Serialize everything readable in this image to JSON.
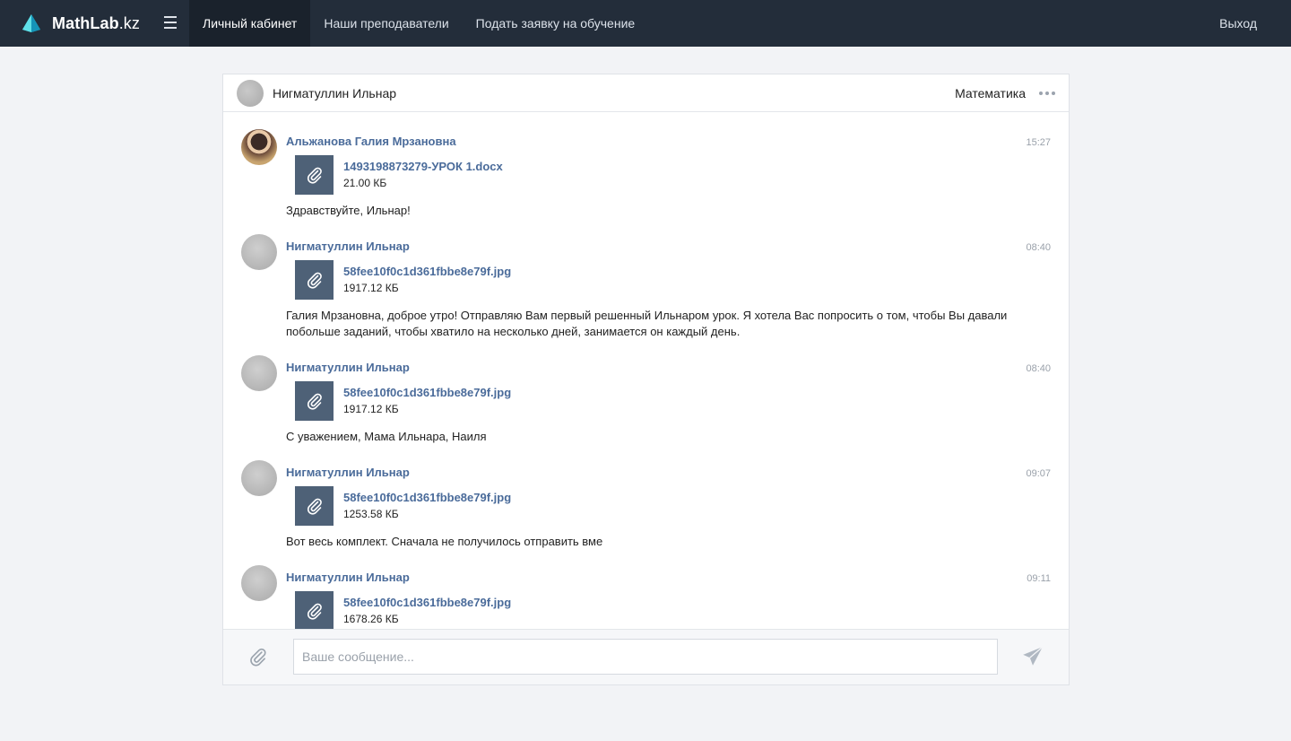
{
  "header": {
    "brand_name": "MathLab",
    "brand_suffix": ".kz",
    "nav": [
      {
        "label": "Личный кабинет"
      },
      {
        "label": "Наши преподаватели"
      },
      {
        "label": "Подать заявку на обучение"
      }
    ],
    "logout_label": "Выход"
  },
  "chat": {
    "contact_name": "Нигматуллин Ильнар",
    "subject": "Математика",
    "messages": [
      {
        "author": "Альжанова Галия Мрзановна",
        "time": "15:27",
        "file_name": "1493198873279-УРОК 1.docx",
        "file_size": "21.00 КБ",
        "text": "Здравствуйте, Ильнар!"
      },
      {
        "author": "Нигматуллин Ильнар",
        "time": "08:40",
        "file_name": "58fee10f0c1d361fbbe8e79f.jpg",
        "file_size": "1917.12 КБ",
        "text": " Галия Мрзановна, доброе утро! Отправляю Вам первый решенный Ильнаром урок. Я хотела Вас попросить о том, чтобы Вы давали побольше заданий, чтобы хватило на несколько дней, занимается он каждый день."
      },
      {
        "author": "Нигматуллин Ильнар",
        "time": "08:40",
        "file_name": "58fee10f0c1d361fbbe8e79f.jpg",
        "file_size": "1917.12 КБ",
        "text": "С уважением, Мама Ильнара, Наиля"
      },
      {
        "author": "Нигматуллин Ильнар",
        "time": "09:07",
        "file_name": "58fee10f0c1d361fbbe8e79f.jpg",
        "file_size": "1253.58 КБ",
        "text": "Вот весь комплект. Сначала не получилось отправить вме"
      },
      {
        "author": "Нигматуллин Ильнар",
        "time": "09:11",
        "file_name": "58fee10f0c1d361fbbe8e79f.jpg",
        "file_size": "1678.26 КБ",
        "text": ""
      }
    ],
    "input_placeholder": "Ваше сообщение...",
    "icons": {
      "attach": "paperclip-icon",
      "send": "send-icon",
      "menu": "more-dots-icon",
      "burger": "menu-icon"
    }
  }
}
